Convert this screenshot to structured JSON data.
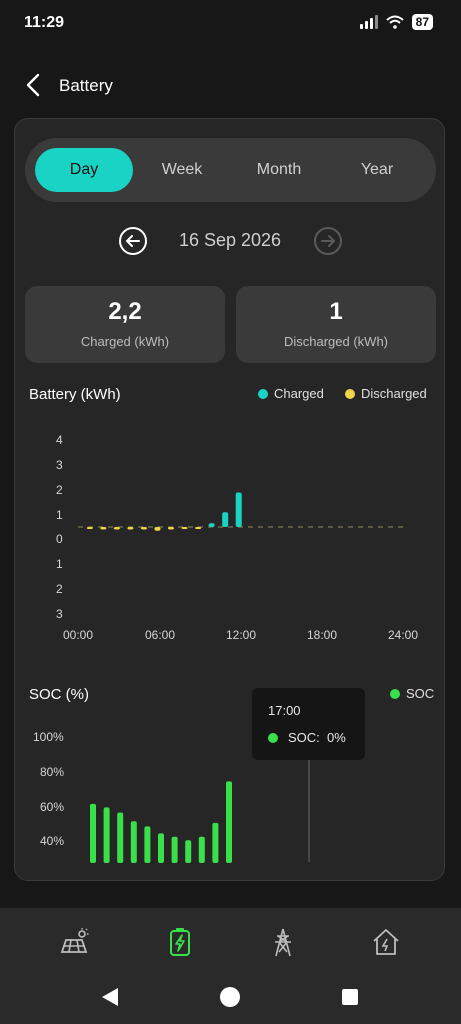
{
  "status": {
    "time": "11:29",
    "battery": "87"
  },
  "header": {
    "title": "Battery"
  },
  "tabs": [
    {
      "label": "Day",
      "active": true
    },
    {
      "label": "Week",
      "active": false
    },
    {
      "label": "Month",
      "active": false
    },
    {
      "label": "Year",
      "active": false
    }
  ],
  "date": "16 Sep 2026",
  "stats": {
    "charged": {
      "value": "2,2",
      "label": "Charged (kWh)"
    },
    "discharged": {
      "value": "1",
      "label": "Discharged (kWh)"
    }
  },
  "battery_chart": {
    "title": "Battery (kWh)",
    "legend": [
      {
        "label": "Charged",
        "color": "#19d3c4"
      },
      {
        "label": "Discharged",
        "color": "#f0d44a"
      }
    ],
    "y_ticks": [
      "4",
      "3",
      "2",
      "1",
      "0",
      "1",
      "2",
      "3"
    ],
    "x_ticks": [
      "00:00",
      "06:00",
      "12:00",
      "18:00",
      "24:00"
    ]
  },
  "soc_chart": {
    "title": "SOC (%)",
    "legend": {
      "label": "SOC",
      "color": "#3ae04a"
    },
    "y_ticks": [
      "100%",
      "80%",
      "60%",
      "40%"
    ],
    "tooltip": {
      "time": "17:00",
      "label": "SOC:",
      "value": "0%"
    }
  },
  "chart_data": [
    {
      "type": "bar",
      "title": "Battery (kWh)",
      "x": [
        "00:00",
        "01:00",
        "02:00",
        "03:00",
        "04:00",
        "05:00",
        "06:00",
        "07:00",
        "08:00",
        "09:00",
        "10:00",
        "11:00"
      ],
      "series": [
        {
          "name": "Charged",
          "color": "#19d3c4",
          "values": [
            0,
            0,
            0,
            0,
            0,
            0,
            0,
            0,
            0,
            0.15,
            0.6,
            1.4
          ]
        },
        {
          "name": "Discharged",
          "color": "#f0d44a",
          "values": [
            0.05,
            0.1,
            0.1,
            0.1,
            0.1,
            0.15,
            0.1,
            0.05,
            0.05,
            0,
            0,
            0
          ]
        }
      ],
      "ylim": [
        -3,
        4
      ],
      "x_range": [
        "00:00",
        "24:00"
      ],
      "legend": "top-right",
      "grid": false
    },
    {
      "type": "bar",
      "title": "SOC (%)",
      "x": [
        "00:00",
        "01:00",
        "02:00",
        "03:00",
        "04:00",
        "05:00",
        "06:00",
        "07:00",
        "08:00",
        "09:00",
        "10:00",
        "11:00"
      ],
      "series": [
        {
          "name": "SOC",
          "color": "#3ae04a",
          "values": [
            62,
            60,
            57,
            52,
            49,
            45,
            43,
            41,
            43,
            51,
            75,
            0
          ]
        }
      ],
      "ylim": [
        30,
        100
      ],
      "legend": "top-right",
      "grid": false
    }
  ],
  "bottom_nav": [
    {
      "icon": "solar-panel-icon",
      "active": false
    },
    {
      "icon": "battery-icon",
      "active": true,
      "color": "#3ae04a"
    },
    {
      "icon": "grid-tower-icon",
      "active": false
    },
    {
      "icon": "home-icon",
      "active": false
    }
  ]
}
